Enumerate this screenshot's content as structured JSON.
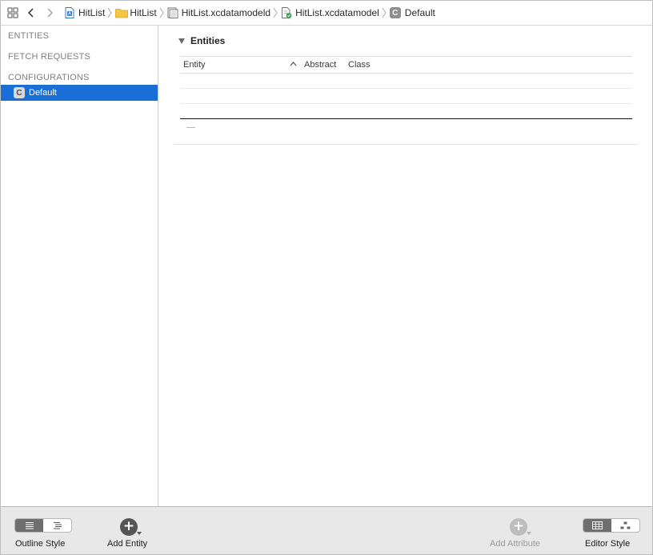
{
  "jumpbar": {
    "crumbs": [
      {
        "label": "HitList",
        "icon": "project-file-icon"
      },
      {
        "label": "HitList",
        "icon": "folder-icon"
      },
      {
        "label": "HitList.xcdatamodeld",
        "icon": "datamodel-bundle-icon"
      },
      {
        "label": "HitList.xcdatamodel",
        "icon": "datamodel-file-icon"
      },
      {
        "label": "Default",
        "icon": "configuration-icon"
      }
    ]
  },
  "sidebar": {
    "entities_header": "ENTITIES",
    "fetch_requests_header": "FETCH REQUESTS",
    "configurations_header": "CONFIGURATIONS",
    "selected_item": {
      "badge": "C",
      "label": "Default"
    }
  },
  "main": {
    "section_title": "Entities",
    "columns": {
      "entity": "Entity",
      "abstract": "Abstract",
      "class": "Class"
    }
  },
  "toolbar": {
    "outline_style_label": "Outline Style",
    "add_entity_label": "Add Entity",
    "add_attribute_label": "Add Attribute",
    "editor_style_label": "Editor Style"
  },
  "colors": {
    "selection": "#1a6fd6",
    "toolbar_bg": "#e8e8e8"
  }
}
